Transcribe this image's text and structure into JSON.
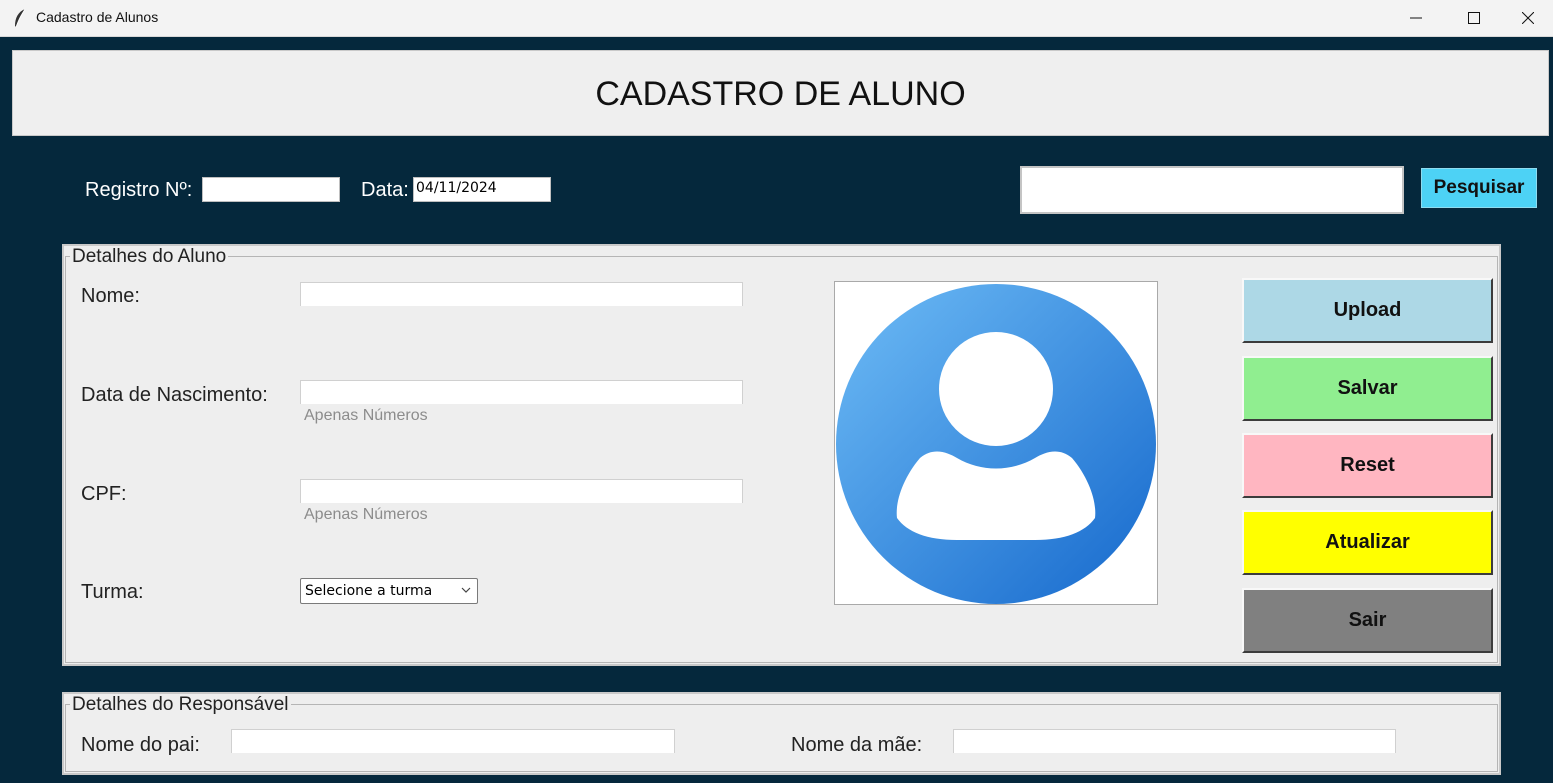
{
  "window": {
    "title": "Cadastro de Alunos",
    "controls": {
      "minimize_icon": "minimize-icon",
      "maximize_icon": "maximize-icon",
      "close_icon": "close-icon"
    }
  },
  "header": {
    "title": "CADASTRO DE ALUNO"
  },
  "top_bar": {
    "registro_label": "Registro Nº:",
    "registro_value": "",
    "data_label": "Data:",
    "data_value": "04/11/2024",
    "search_value": "",
    "search_button": "Pesquisar"
  },
  "aluno_section": {
    "legend": "Detalhes do Aluno",
    "nome_label": "Nome:",
    "nome_value": "",
    "nascimento_label": "Data de Nascimento:",
    "nascimento_value": "",
    "nascimento_hint": "Apenas Números",
    "cpf_label": "CPF:",
    "cpf_value": "",
    "cpf_hint": "Apenas Números",
    "turma_label": "Turma:",
    "turma_selected": "Selecione a turma",
    "photo_icon": "user-avatar-icon"
  },
  "actions": {
    "upload": {
      "label": "Upload",
      "color": "#add8e6"
    },
    "salvar": {
      "label": "Salvar",
      "color": "#90ee90"
    },
    "reset": {
      "label": "Reset",
      "color": "#ffb6c1"
    },
    "atualizar": {
      "label": "Atualizar",
      "color": "#ffff00"
    },
    "sair": {
      "label": "Sair",
      "color": "#808080"
    }
  },
  "responsavel_section": {
    "legend": "Detalhes do Responsável",
    "pai_label": "Nome do pai:",
    "pai_value": "",
    "mae_label": "Nome da mãe:",
    "mae_value": ""
  },
  "colors": {
    "background": "#05283c",
    "search_button": "#4dd2f5",
    "avatar_gradient_start": "#66b6f4",
    "avatar_gradient_end": "#1a6fd2"
  }
}
